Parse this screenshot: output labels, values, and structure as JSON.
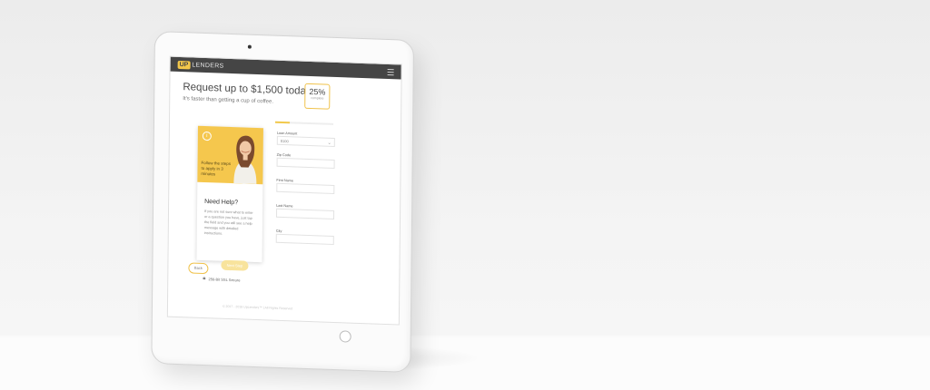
{
  "app": {
    "logo_mark": "UP",
    "logo_text": "LENDERS"
  },
  "hero": {
    "headline": "Request up to $1,500 today!",
    "subheadline": "It's faster than getting a cup of coffee."
  },
  "progress": {
    "percent_label": "25%",
    "sub_label": "complete",
    "value": 0.25
  },
  "promo": {
    "text": "Follow the steps to apply in 3 minutes",
    "help_title": "Need Help?",
    "help_text": "If you are not sure what to enter or a question you have, just tap the field and you will see a help message with detailed instructions."
  },
  "security": {
    "label": "256-Bit SSL Secure"
  },
  "form": {
    "loan_amount_label": "Loan Amount",
    "loan_amount_value": "$100",
    "zip_label": "Zip Code",
    "first_name_label": "First Name",
    "last_name_label": "Last Name",
    "city_label": "City",
    "back_label": "Back",
    "next_label": "Next Step"
  },
  "footer": {
    "text": "© 2017 - 2018 UpLenders™ | All Rights Reserved"
  },
  "colors": {
    "accent": "#f5c74d",
    "header_bg": "#454545"
  }
}
